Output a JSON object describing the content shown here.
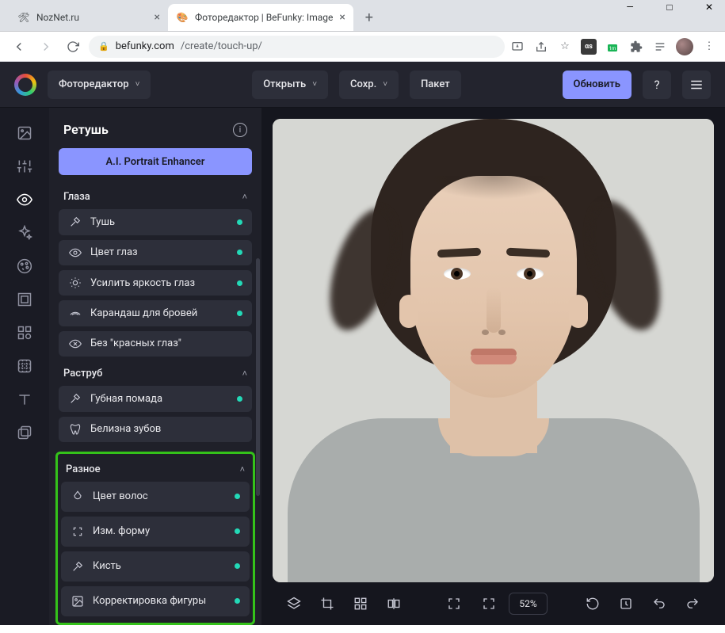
{
  "window": {
    "min": "—",
    "max": "□",
    "close": "✕"
  },
  "tabs": [
    {
      "title": "NozNet.ru",
      "active": false
    },
    {
      "title": "Фоторедактор | BeFunky: Image",
      "active": true
    }
  ],
  "new_tab": "+",
  "address": {
    "host": "befunky.com",
    "path": "/create/touch-up/"
  },
  "header": {
    "editor": "Фоторедактор",
    "open": "Открыть",
    "save": "Сохр.",
    "batch": "Пакет",
    "upgrade": "Обновить"
  },
  "sidebar": {
    "title": "Ретушь",
    "ai_button": "A.I. Portrait Enhancer",
    "groups": {
      "eyes": {
        "label": "Глаза",
        "items": [
          {
            "label": "Тушь",
            "dot": true
          },
          {
            "label": "Цвет глаз",
            "dot": true
          },
          {
            "label": "Усилить яркость глаз",
            "dot": true
          },
          {
            "label": "Карандаш для бровей",
            "dot": true
          },
          {
            "label": "Без \"красных глаз\"",
            "dot": false
          }
        ]
      },
      "mouth": {
        "label": "Раструб",
        "items": [
          {
            "label": "Губная помада",
            "dot": true
          },
          {
            "label": "Белизна зубов",
            "dot": false
          }
        ]
      },
      "misc": {
        "label": "Разное",
        "items": [
          {
            "label": "Цвет волос",
            "dot": true
          },
          {
            "label": "Изм. форму",
            "dot": true
          },
          {
            "label": "Кисть",
            "dot": true
          },
          {
            "label": "Корректировка фигуры",
            "dot": true
          }
        ]
      }
    }
  },
  "bottombar": {
    "zoom": "52%"
  },
  "icons": {
    "info": "i",
    "help": "?",
    "chev": "˅",
    "chev_up": "˄"
  }
}
